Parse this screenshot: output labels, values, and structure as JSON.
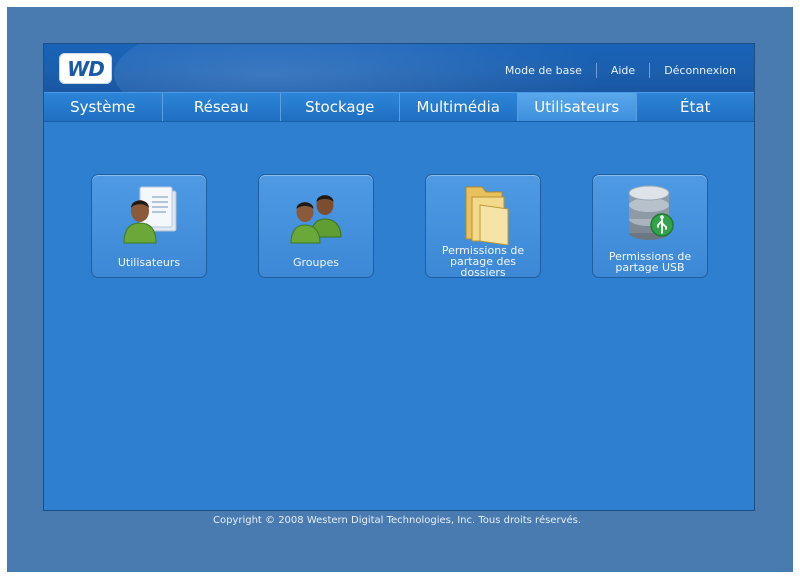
{
  "header": {
    "logo_text": "WD",
    "links": [
      "Mode de base",
      "Aide",
      "Déconnexion"
    ]
  },
  "tabs": [
    {
      "label": "Système",
      "active": false
    },
    {
      "label": "Réseau",
      "active": false
    },
    {
      "label": "Stockage",
      "active": false
    },
    {
      "label": "Multimédia",
      "active": false
    },
    {
      "label": "Utilisateurs",
      "active": true
    },
    {
      "label": "État",
      "active": false
    }
  ],
  "tiles": [
    {
      "label": "Utilisateurs",
      "icon": "user-card-icon"
    },
    {
      "label": "Groupes",
      "icon": "group-icon"
    },
    {
      "label": "Permissions de partage des dossiers",
      "icon": "folder-icon"
    },
    {
      "label": "Permissions de partage USB",
      "icon": "usb-drive-icon"
    }
  ],
  "footer": {
    "copyright": "Copyright © 2008 Western Digital Technologies, Inc. Tous droits réservés."
  },
  "colors": {
    "page_bg": "#4a7bb0",
    "panel_bg": "#2f7fd0",
    "tab_active": "#4c9ce6"
  }
}
